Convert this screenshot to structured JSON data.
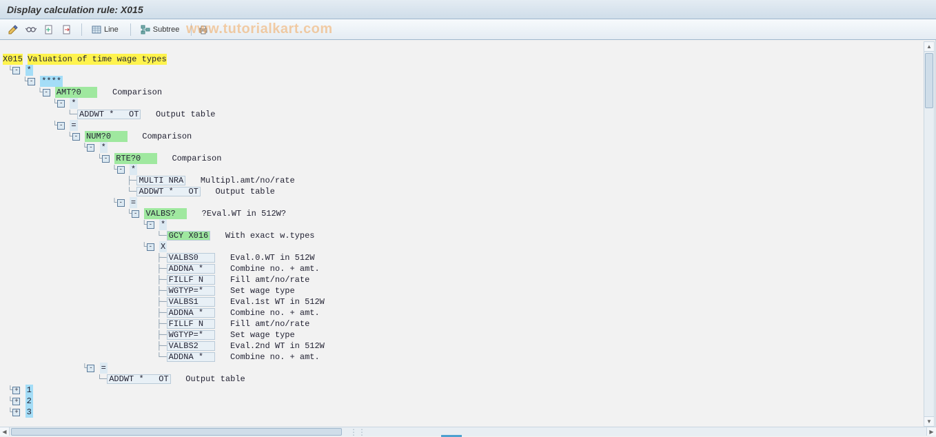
{
  "title": "Display calculation rule: X015",
  "watermark": "www.tutorialkart.com",
  "toolbar": {
    "line_label": "Line",
    "subtree_label": "Subtree"
  },
  "icons": {
    "pencil": "pencil-icon",
    "glasses": "glasses-icon",
    "doc_plus": "doc-plus-icon",
    "doc_arrow": "doc-arrow-icon",
    "grid": "grid-icon",
    "tree": "tree-icon",
    "print": "print-icon"
  },
  "root": {
    "code": "X015",
    "desc": "Valuation of time wage types"
  },
  "tree": [
    {
      "ind": 1,
      "exp": "E",
      "lbl": "*",
      "cls": "hl-blue"
    },
    {
      "ind": 2,
      "exp": "E",
      "lbl": "****",
      "cls": "hl-blue"
    },
    {
      "ind": 3,
      "exp": "E",
      "lbl": "AMT?0   ",
      "cls": "hl-green",
      "extra": "   Comparison"
    },
    {
      "ind": 4,
      "exp": "E",
      "lbl": "*",
      "cls": ""
    },
    {
      "ind": 5,
      "leaf": true,
      "op": "ADDWT *   OT",
      "desc": "Output table"
    },
    {
      "ind": 4,
      "exp": "E",
      "lbl": "=",
      "cls": ""
    },
    {
      "ind": 5,
      "exp": "E",
      "lbl": "NUM?0   ",
      "cls": "hl-green",
      "extra": "   Comparison"
    },
    {
      "ind": 6,
      "exp": "E",
      "lbl": "*",
      "cls": ""
    },
    {
      "ind": 7,
      "exp": "E",
      "lbl": "RTE?0   ",
      "cls": "hl-green",
      "extra": "   Comparison"
    },
    {
      "ind": 8,
      "exp": "E",
      "lbl": "*",
      "cls": ""
    },
    {
      "ind": 9,
      "leaf": true,
      "mid": true,
      "op": "MULTI NRA",
      "desc": "Multipl.amt/no/rate"
    },
    {
      "ind": 9,
      "leaf": true,
      "op": "ADDWT *   OT",
      "desc": "Output table"
    },
    {
      "ind": 8,
      "exp": "E",
      "lbl": "=",
      "cls": ""
    },
    {
      "ind": 9,
      "exp": "E",
      "lbl": "VALBS?  ",
      "cls": "hl-green",
      "extra": "   ?Eval.WT in 512W?"
    },
    {
      "ind": 10,
      "exp": "E",
      "lbl": "*",
      "cls": ""
    },
    {
      "ind": 11,
      "leaf": true,
      "op_hl": "GCY X016",
      "desc": "With exact w.types"
    },
    {
      "ind": 10,
      "exp": "E",
      "lbl": "X",
      "cls": ""
    },
    {
      "ind": 11,
      "leaf": true,
      "mid": true,
      "op": "VALBS0   ",
      "desc": "Eval.0.WT in 512W"
    },
    {
      "ind": 11,
      "leaf": true,
      "mid": true,
      "op": "ADDNA *  ",
      "desc": "Combine no. + amt."
    },
    {
      "ind": 11,
      "leaf": true,
      "mid": true,
      "op": "FILLF N  ",
      "desc": "Fill amt/no/rate"
    },
    {
      "ind": 11,
      "leaf": true,
      "mid": true,
      "op": "WGTYP=*  ",
      "desc": "Set wage type"
    },
    {
      "ind": 11,
      "leaf": true,
      "mid": true,
      "op": "VALBS1   ",
      "desc": "Eval.1st WT in 512W"
    },
    {
      "ind": 11,
      "leaf": true,
      "mid": true,
      "op": "ADDNA *  ",
      "desc": "Combine no. + amt."
    },
    {
      "ind": 11,
      "leaf": true,
      "mid": true,
      "op": "FILLF N  ",
      "desc": "Fill amt/no/rate"
    },
    {
      "ind": 11,
      "leaf": true,
      "mid": true,
      "op": "WGTYP=*  ",
      "desc": "Set wage type"
    },
    {
      "ind": 11,
      "leaf": true,
      "mid": true,
      "op": "VALBS2   ",
      "desc": "Eval.2nd WT in 512W"
    },
    {
      "ind": 11,
      "leaf": true,
      "op": "ADDNA *  ",
      "desc": "Combine no. + amt."
    },
    {
      "ind": 6,
      "exp": "E",
      "lbl": "=",
      "cls": ""
    },
    {
      "ind": 7,
      "leaf": true,
      "op": "ADDWT *   OT",
      "desc": "Output table"
    },
    {
      "ind": 1,
      "exp": "H",
      "lbl": "1",
      "cls": "hl-blue"
    },
    {
      "ind": 1,
      "exp": "H",
      "lbl": "2",
      "cls": "hl-blue"
    },
    {
      "ind": 1,
      "exp": "H",
      "lbl": "3",
      "cls": "hl-blue"
    }
  ]
}
